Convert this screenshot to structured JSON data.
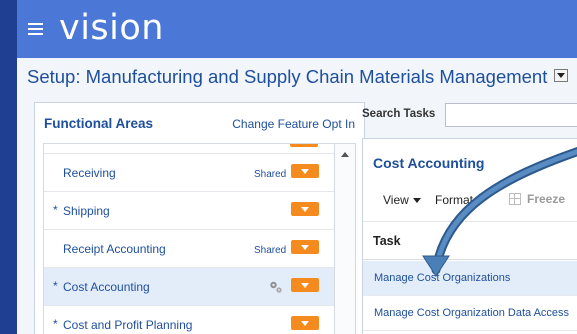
{
  "app": {
    "brand": "vision"
  },
  "page": {
    "title": "Setup: Manufacturing and Supply Chain Materials Management"
  },
  "functional_areas": {
    "title": "Functional Areas",
    "change_link": "Change Feature Opt In",
    "items": [
      {
        "label": "Receiving",
        "required": false,
        "shared": "Shared",
        "selected": false,
        "gears": false
      },
      {
        "label": "Shipping",
        "required": true,
        "shared": "",
        "selected": false,
        "gears": false
      },
      {
        "label": "Receipt Accounting",
        "required": false,
        "shared": "Shared",
        "selected": false,
        "gears": false
      },
      {
        "label": "Cost Accounting",
        "required": true,
        "shared": "",
        "selected": true,
        "gears": true
      },
      {
        "label": "Cost and Profit Planning",
        "required": true,
        "shared": "",
        "selected": false,
        "gears": false
      }
    ]
  },
  "search": {
    "label": "Search Tasks",
    "value": ""
  },
  "cost_accounting": {
    "title": "Cost Accounting",
    "toolbar": {
      "view": "View",
      "format": "Format",
      "freeze": "Freeze"
    },
    "column_header": "Task",
    "tasks": [
      {
        "label": "Manage Cost Organizations",
        "selected": true
      },
      {
        "label": "Manage Cost Organization Data Access",
        "selected": false
      }
    ]
  },
  "colors": {
    "header": "#4b78d6",
    "accent_orange": "#f58b1f",
    "link": "#1e4f9c",
    "annotation_arrow": "#3d6ea8"
  }
}
